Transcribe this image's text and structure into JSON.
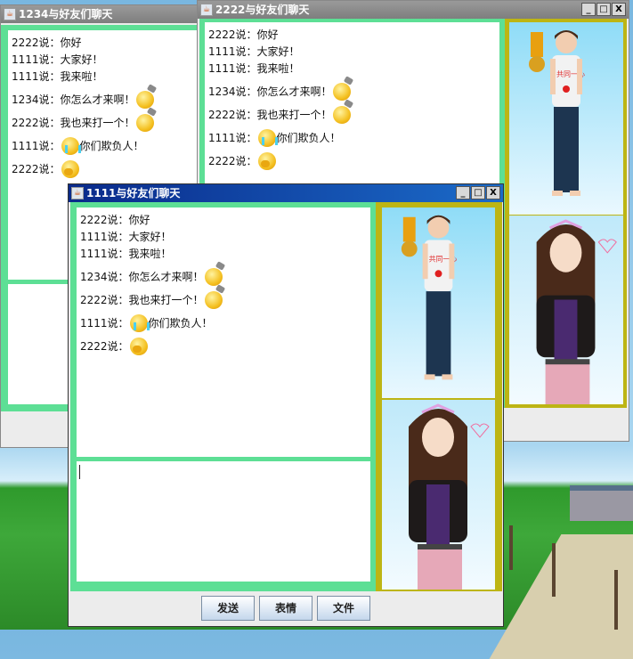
{
  "windows": [
    {
      "id": "1234",
      "title": "1234与好友们聊天",
      "active": false
    },
    {
      "id": "2222",
      "title": "2222与好友们聊天",
      "active": false
    },
    {
      "id": "1111",
      "title": "1111与好友们聊天",
      "active": true
    }
  ],
  "chat": [
    {
      "sender": "2222说：",
      "text": "你好",
      "emoji": null
    },
    {
      "sender": "1111说：",
      "text": "大家好！",
      "emoji": null
    },
    {
      "sender": "1111说：",
      "text": "我来啦！",
      "emoji": null
    },
    {
      "sender": "1234说：",
      "text": "你怎么才来啊！",
      "emoji": "hammer",
      "emoji_after": true
    },
    {
      "sender": "2222说：",
      "text": "我也来打一个！",
      "emoji": "hammer",
      "emoji_after": true
    },
    {
      "sender": "1111说：",
      "text": "你们欺负人！",
      "emoji": "cry",
      "emoji_after": false
    },
    {
      "sender": "2222说：",
      "text": "",
      "emoji": "cover",
      "emoji_after": true
    }
  ],
  "buttons": {
    "send": "发送",
    "emoticon": "表情",
    "file": "文件"
  },
  "window_controls": {
    "minimize": "_",
    "maximize": "□",
    "close": "X"
  },
  "colors": {
    "panel_green": "#5ddf95",
    "avatar_border": "#bdb514",
    "active_title": "#0a2a8a"
  }
}
